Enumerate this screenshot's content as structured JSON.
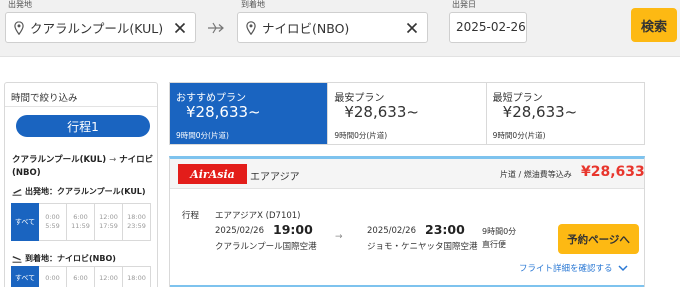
{
  "search": {
    "origin_label": "出発地",
    "origin_value": "クアラルンプール(KUL)",
    "destination_label": "到着地",
    "destination_value": "ナイロビ(NBO)",
    "date_label": "出発日",
    "date_value": "2025-02-26",
    "search_button": "検索"
  },
  "sidebar": {
    "title": "時間で絞り込み",
    "trip_button": "行程1",
    "route_from": "クアラルンプール(KUL)",
    "route_arrow": "→",
    "route_to": "ナイロビ(NBO)",
    "departure_heading": "出発地：クアラルンプール(KUL)",
    "arrival_heading": "到着地：ナイロビ(NBO)",
    "slots": [
      {
        "label": "すべて",
        "from": "",
        "to": ""
      },
      {
        "label": "",
        "from": "0:00",
        "to": "5:59"
      },
      {
        "label": "",
        "from": "6:00",
        "to": "11:59"
      },
      {
        "label": "",
        "from": "12:00",
        "to": "17:59"
      },
      {
        "label": "",
        "from": "18:00",
        "to": "23:59"
      }
    ],
    "arrival_slots": [
      {
        "label": "すべて",
        "from": "",
        "to": ""
      },
      {
        "label": "",
        "from": "0:00",
        "to": ""
      },
      {
        "label": "",
        "from": "6:00",
        "to": ""
      },
      {
        "label": "",
        "from": "12:00",
        "to": ""
      },
      {
        "label": "",
        "from": "18:00",
        "to": ""
      }
    ]
  },
  "tabs": [
    {
      "label": "おすすめプラン",
      "price": "¥28,633~",
      "duration": "9時間0分(片道)",
      "active": true
    },
    {
      "label": "最安プラン",
      "price": "¥28,633~",
      "duration": "9時間0分(片道)",
      "active": false
    },
    {
      "label": "最短プラン",
      "price": "¥28,633~",
      "duration": "9時間0分(片道)",
      "active": false
    }
  ],
  "flight": {
    "logo_text": "AirAsia",
    "airline": "エアアジア",
    "fare_note": "片道 / 燃油費等込み",
    "fare": "¥28,633",
    "row_label": "行程",
    "flight_number": "エアアジアX (D7101)",
    "dep_date": "2025/02/26",
    "dep_time": "19:00",
    "dep_airport": "クアラルンプール国際空港",
    "arrow": "→",
    "arr_date": "2025/02/26",
    "arr_time": "23:00",
    "arr_airport": "ジョモ・ケニヤッタ国際空港",
    "duration": "9時間0分",
    "direct": "直行便",
    "book_button": "予約ページへ",
    "details_link": "フライト詳細を確認する"
  },
  "colors": {
    "brand_blue": "#1a64c0",
    "accent_yellow": "#fdb913",
    "price_red": "#e8362d",
    "card_top": "#7ec3ee",
    "logo_red": "#e31d1a",
    "link_blue": "#2a78d4"
  }
}
